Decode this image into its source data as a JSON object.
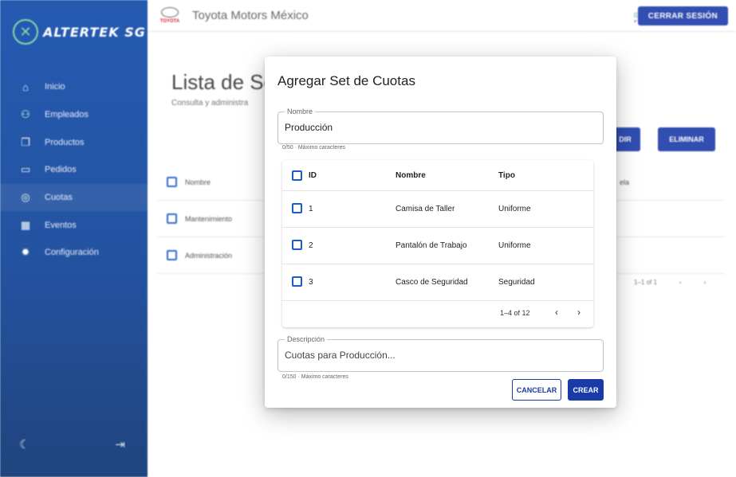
{
  "sidebar": {
    "logo_text": "ALTERTEK SG",
    "items": [
      {
        "label": "Inicio",
        "icon": "home-icon",
        "glyph": "⌂"
      },
      {
        "label": "Empleados",
        "icon": "people-icon",
        "glyph": "⚇"
      },
      {
        "label": "Productos",
        "icon": "cube-icon",
        "glyph": "❒"
      },
      {
        "label": "Pedidos",
        "icon": "inbox-icon",
        "glyph": "▭"
      },
      {
        "label": "Cuotas",
        "icon": "coins-icon",
        "glyph": "◎"
      },
      {
        "label": "Eventos",
        "icon": "calendar-icon",
        "glyph": "▦"
      },
      {
        "label": "Configuración",
        "icon": "gear-icon",
        "glyph": "✹"
      }
    ],
    "active_index": 4,
    "moon_glyph": "☾",
    "logout_glyph": "⇥"
  },
  "topbar": {
    "brand_word": "TOYOTA",
    "company": "Toyota Motors México",
    "cart_glyph": "🛒",
    "logout_label": "CERRAR SESIÓN"
  },
  "background": {
    "title": "Lista de Se",
    "subtitle": "Consulta y administra",
    "edit_label": "DIR",
    "delete_label": "ELIMINAR",
    "table_header": "Nombre",
    "table_header_extra": "ela",
    "rows": [
      "Mantenimiento",
      "Administración"
    ],
    "pager_info": "1–1 of 1",
    "prev": "‹",
    "next": "›"
  },
  "modal": {
    "title": "Agregar Set de Cuotas",
    "name_field": {
      "label": "Nombre",
      "value": "Producción",
      "helper": "0/50 · Máximo caracteres"
    },
    "table": {
      "headers": {
        "id": "ID",
        "name": "Nombre",
        "type": "Tipo"
      },
      "rows": [
        {
          "id": "1",
          "name": "Camisa de Taller",
          "type": "Uniforme"
        },
        {
          "id": "2",
          "name": "Pantalón de Trabajo",
          "type": "Uniforme"
        },
        {
          "id": "3",
          "name": "Casco de Seguridad",
          "type": "Seguridad"
        }
      ],
      "pager": {
        "info": "1–4 of 12",
        "prev": "‹",
        "next": "›"
      }
    },
    "description_field": {
      "label": "Descripción",
      "placeholder": "Cuotas para Producción...",
      "helper": "0/150 · Máximo caracteres"
    },
    "cancel_label": "CANCELAR",
    "create_label": "CREAR"
  },
  "colors": {
    "primary": "#1a3aa8",
    "sidebar": "#0d48a8",
    "checkbox": "#1a5cc8"
  }
}
